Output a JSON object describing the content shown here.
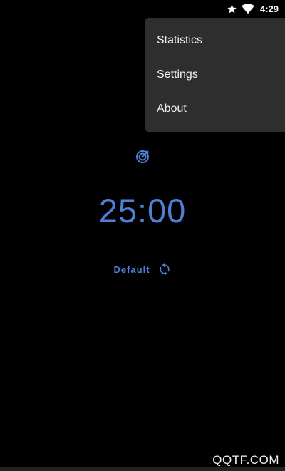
{
  "status_bar": {
    "time": "4:29",
    "icons": [
      "star-icon",
      "wifi-icon"
    ]
  },
  "menu": {
    "items": [
      {
        "label": "Statistics"
      },
      {
        "label": "Settings"
      },
      {
        "label": "About"
      }
    ]
  },
  "timer": {
    "icon": "target-icon",
    "display": "25:00",
    "label": "Default",
    "refresh_icon": "refresh-icon"
  },
  "watermark": {
    "text": "QQTF.COM"
  },
  "colors": {
    "accent": "#4f7fd6",
    "background": "#000000",
    "menu_background": "#2e2e2e"
  }
}
